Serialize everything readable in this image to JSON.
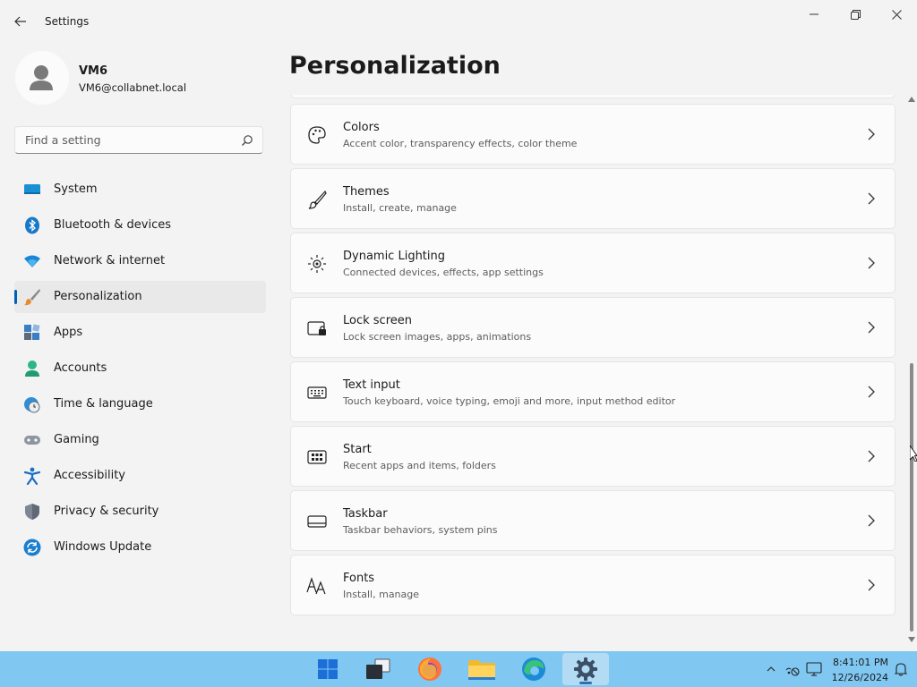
{
  "window": {
    "title": "Settings",
    "controls": [
      "minimize",
      "maximize",
      "close"
    ]
  },
  "profile": {
    "name": "VM6",
    "email": "VM6@collabnet.local"
  },
  "search": {
    "placeholder": "Find a setting",
    "value": ""
  },
  "sidebar": {
    "active": "Personalization",
    "items": [
      {
        "label": "System",
        "icon": "system-icon"
      },
      {
        "label": "Bluetooth & devices",
        "icon": "bluetooth-icon"
      },
      {
        "label": "Network & internet",
        "icon": "wifi-icon"
      },
      {
        "label": "Personalization",
        "icon": "brush-icon"
      },
      {
        "label": "Apps",
        "icon": "apps-icon"
      },
      {
        "label": "Accounts",
        "icon": "account-icon"
      },
      {
        "label": "Time & language",
        "icon": "time-language-icon"
      },
      {
        "label": "Gaming",
        "icon": "gamepad-icon"
      },
      {
        "label": "Accessibility",
        "icon": "accessibility-icon"
      },
      {
        "label": "Privacy & security",
        "icon": "shield-icon"
      },
      {
        "label": "Windows Update",
        "icon": "update-icon"
      }
    ]
  },
  "main": {
    "title": "Personalization",
    "cards": [
      {
        "title": "Colors",
        "subtitle": "Accent color, transparency effects, color theme",
        "icon": "palette-icon"
      },
      {
        "title": "Themes",
        "subtitle": "Install, create, manage",
        "icon": "brush-icon"
      },
      {
        "title": "Dynamic Lighting",
        "subtitle": "Connected devices, effects, app settings",
        "icon": "lighting-icon"
      },
      {
        "title": "Lock screen",
        "subtitle": "Lock screen images, apps, animations",
        "icon": "lock-screen-icon"
      },
      {
        "title": "Text input",
        "subtitle": "Touch keyboard, voice typing, emoji and more, input method editor",
        "icon": "keyboard-icon"
      },
      {
        "title": "Start",
        "subtitle": "Recent apps and items, folders",
        "icon": "start-icon"
      },
      {
        "title": "Taskbar",
        "subtitle": "Taskbar behaviors, system pins",
        "icon": "taskbar-icon"
      },
      {
        "title": "Fonts",
        "subtitle": "Install, manage",
        "icon": "fonts-icon"
      }
    ]
  },
  "taskbar": {
    "apps": [
      "start-icon",
      "task-view-icon",
      "firefox-icon",
      "file-explorer-icon",
      "edge-icon",
      "settings-icon"
    ],
    "active_app": "settings-icon",
    "tray": [
      "chevron-up-icon",
      "network-icon",
      "monitor-icon"
    ],
    "time": "8:41:01 PM",
    "date": "12/26/2024"
  },
  "colors": {
    "accent": "#005fb8",
    "background": "#f3f3f3",
    "card": "#fbfbfb",
    "taskbar": "#80c8f2"
  }
}
